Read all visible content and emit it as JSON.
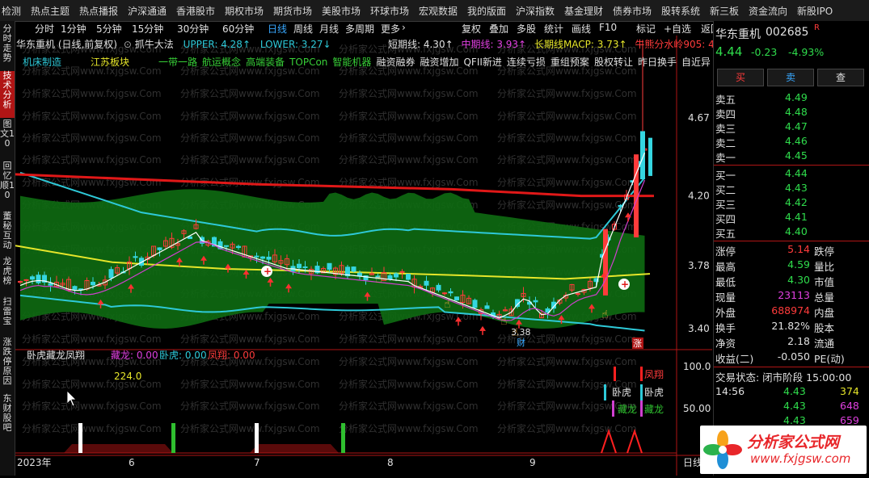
{
  "topbar": [
    "检测",
    "热点主题",
    "热点播报",
    "沪深通通",
    "香港股市",
    "期权市场",
    "期货市场",
    "美股市场",
    "环球市场",
    "宏观数据",
    "我的版面",
    "沪深指数",
    "基金理财",
    "债券市场",
    "股转系统",
    "新三板",
    "资金流向",
    "新股IPO"
  ],
  "sidebar": [
    "分时走势",
    "技术分析",
    "图文10",
    "回忆顺10",
    "董秘互动",
    "龙虎榜",
    "扫雷宝",
    "涨跌停原因",
    "东财股吧"
  ],
  "toolbar": {
    "periods": [
      "分时",
      "1分钟",
      "5分钟",
      "15分钟",
      "30分钟",
      "60分钟",
      "日线",
      "周线",
      "月线",
      "多周期",
      "更多"
    ],
    "active_period": "日线",
    "right_buttons": [
      "复权",
      "叠加",
      "多股",
      "统计",
      "画线",
      "F10",
      "标记",
      "+自选",
      "返回"
    ]
  },
  "chart_header": {
    "title": "华东重机 (日线,前复权)",
    "indicator": "抓牛大法",
    "upper": "UPPER: 4.28↑",
    "lower": "LOWER: 3.27↓",
    "short": "短期线: 4.30↑",
    "mid": "中期线: 3.93↑",
    "long": "长期线MACP: 3.73↑",
    "bull": "牛熊分水岭905: 4.22↑"
  },
  "concept_tags": [
    "机床制造",
    "江苏板块",
    "一带一路",
    "航运概念",
    "高端装备",
    "TOPCon",
    "智能机器",
    "融资融券",
    "融资增加",
    "QFII新进",
    "连续亏损",
    "重组预案",
    "股权转让",
    "昨日换手",
    "自近异动"
  ],
  "price_axis": [
    "4.67",
    "4.20",
    "3.78",
    "3.40"
  ],
  "low_label": "3.38",
  "cai_label": "财",
  "zhang_label": "涨",
  "lower_panel": {
    "title": "卧虎藏龙凤翔",
    "v1": "藏龙: 0.00",
    "v2": "卧虎: 0.00",
    "v3": "凤翔: 0.00",
    "num": "224.0",
    "axis": [
      "100.0",
      "50.00"
    ],
    "tag_fengxiang": "凤翔",
    "tag_wohu": "卧虎",
    "tag_canglong": "藏龙"
  },
  "date_axis": [
    "2023年",
    "6",
    "7",
    "8",
    "9"
  ],
  "date_right": "日线",
  "watermark": "分析家公式网www.fxjgsw.Com",
  "stock": {
    "name": "华东重机",
    "code": "002685",
    "badge": "R",
    "price": "4.44",
    "change": "-0.23",
    "change_pct": "-4.93%"
  },
  "trade_buttons": [
    "买",
    "卖",
    "查"
  ],
  "asks": [
    [
      "卖五",
      "4.49"
    ],
    [
      "卖四",
      "4.48"
    ],
    [
      "卖三",
      "4.47"
    ],
    [
      "卖二",
      "4.46"
    ],
    [
      "卖一",
      "4.45"
    ]
  ],
  "bids": [
    [
      "买一",
      "4.44"
    ],
    [
      "买二",
      "4.43"
    ],
    [
      "买三",
      "4.42"
    ],
    [
      "买四",
      "4.41"
    ],
    [
      "买五",
      "4.40"
    ]
  ],
  "stats": [
    [
      "涨停",
      "5.14",
      "跌停",
      ""
    ],
    [
      "最高",
      "4.59",
      "量比",
      ""
    ],
    [
      "最低",
      "4.30",
      "市值",
      ""
    ],
    [
      "现量",
      "23113",
      "总量",
      ""
    ],
    [
      "外盘",
      "688974",
      "内盘",
      ""
    ],
    [
      "换手",
      "21.82%",
      "股本",
      ""
    ],
    [
      "净资",
      "2.18",
      "流通",
      ""
    ],
    [
      "收益(二)",
      "-0.050",
      "PE(动)",
      ""
    ]
  ],
  "status": "交易状态: 闭市阶段 15:00:00",
  "ticks": [
    [
      "14:56",
      "4.43",
      "374"
    ],
    [
      "",
      "4.43",
      "648"
    ],
    [
      "",
      "4.43",
      "659"
    ]
  ],
  "logo": {
    "name": "分析家公式网",
    "url": "www.fxjgsw.com"
  },
  "colors": {
    "up": "#ff3b3b",
    "down": "#35d6e0",
    "band": "#0e6b12",
    "bull_line": "#e01818",
    "mid_line": "#e6e62a",
    "upper_line": "#2ec9d8"
  }
}
